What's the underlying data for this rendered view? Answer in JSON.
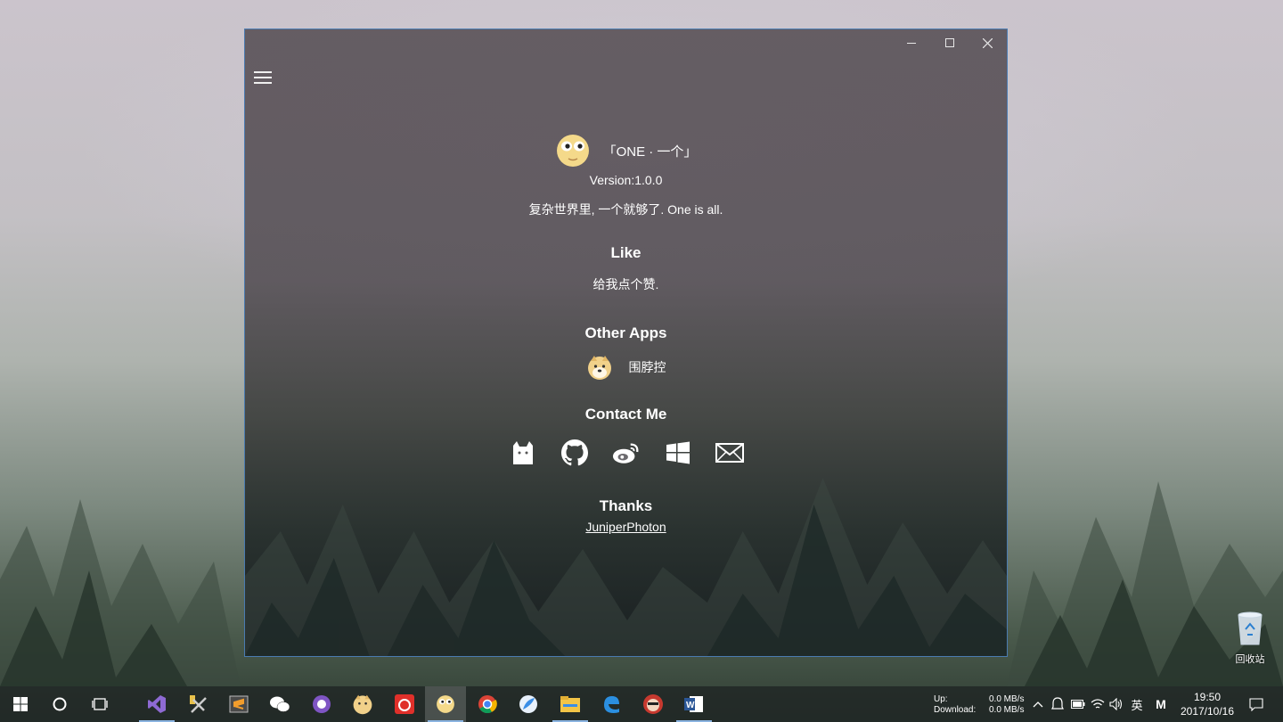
{
  "app": {
    "name": "「ONE · 一个」",
    "version": "Version:1.0.0",
    "slogan": "复杂世界里, 一个就够了. One is all."
  },
  "sections": {
    "like": {
      "title": "Like",
      "text": "给我点个赞."
    },
    "other_apps": {
      "title": "Other Apps",
      "items": [
        {
          "label": "围脖控",
          "icon": "doge-icon"
        }
      ]
    },
    "contact": {
      "title": "Contact Me",
      "icons": [
        "cat-icon",
        "github-icon",
        "weibo-icon",
        "windows-icon",
        "mail-icon"
      ]
    },
    "thanks": {
      "title": "Thanks",
      "link": "JuniperPhoton"
    }
  },
  "window_controls": [
    "minimize-icon",
    "maximize-icon",
    "close-icon"
  ],
  "desktop": {
    "recycle_bin": "回收站"
  },
  "taskbar": {
    "apps": [
      "windows-start-icon",
      "cortana-icon",
      "task-view-icon",
      "visual-studio-icon",
      "tools-icon",
      "sublime-icon",
      "wechat-icon",
      "github-desktop-icon",
      "doge-icon",
      "netease-music-icon",
      "one-app-icon",
      "chrome-icon",
      "feather-icon",
      "file-explorer-icon",
      "edge-icon",
      "avatar-icon",
      "word-icon"
    ],
    "network": {
      "up_label": "Up:",
      "down_label": "Download:",
      "up_value": "0.0 MB/s",
      "down_value": "0.0 MB/s"
    },
    "ime": "英",
    "ime2": "M",
    "time": "19:50",
    "date": "2017/10/16"
  },
  "colors": {
    "window_border": "#4a7bb0",
    "accent": "#8ab4e0"
  }
}
